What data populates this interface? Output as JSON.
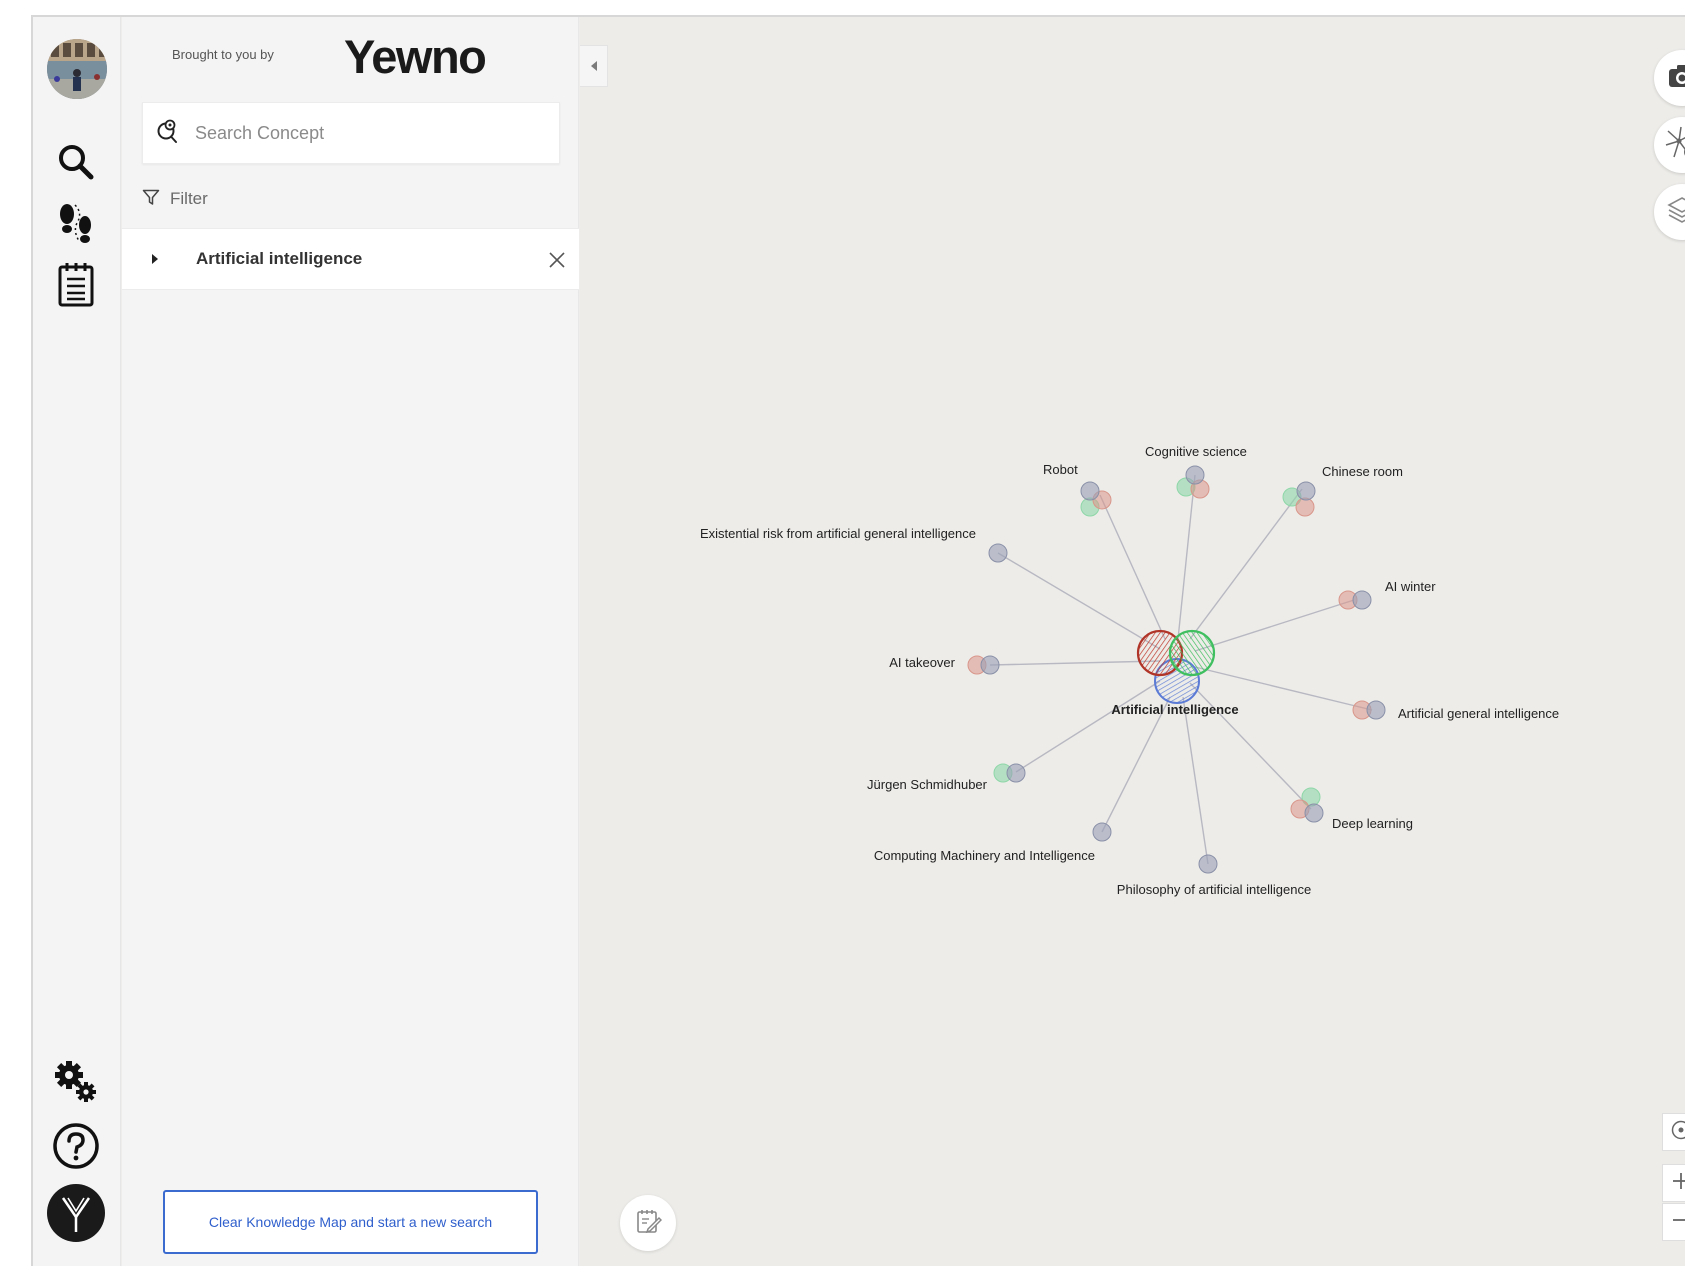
{
  "brand": {
    "tagline": "Brought to you by",
    "name": "Yewno"
  },
  "search": {
    "placeholder": "Search Concept"
  },
  "filter": {
    "label": "Filter"
  },
  "concepts": [
    {
      "label": "Artificial intelligence"
    }
  ],
  "clear_button": {
    "label": "Clear Knowledge Map and start a new search"
  },
  "graph": {
    "center": {
      "label": "Artificial intelligence"
    },
    "nodes": [
      {
        "label": "Robot"
      },
      {
        "label": "Cognitive science"
      },
      {
        "label": "Chinese room"
      },
      {
        "label": "Existential risk from artificial general intelligence"
      },
      {
        "label": "AI winter"
      },
      {
        "label": "AI takeover"
      },
      {
        "label": "Artificial general intelligence"
      },
      {
        "label": "Jürgen Schmidhuber"
      },
      {
        "label": "Deep learning"
      },
      {
        "label": "Computing Machinery and Intelligence"
      },
      {
        "label": "Philosophy of artificial intelligence"
      }
    ]
  },
  "colors": {
    "accent": "#2f5fcc",
    "red": "#c0392b",
    "green": "#3fbf5f",
    "blue": "#5b7bd5",
    "node_gray": "#9aa0b6",
    "node_red": "#d9968a",
    "node_green": "#8ed7a8"
  }
}
